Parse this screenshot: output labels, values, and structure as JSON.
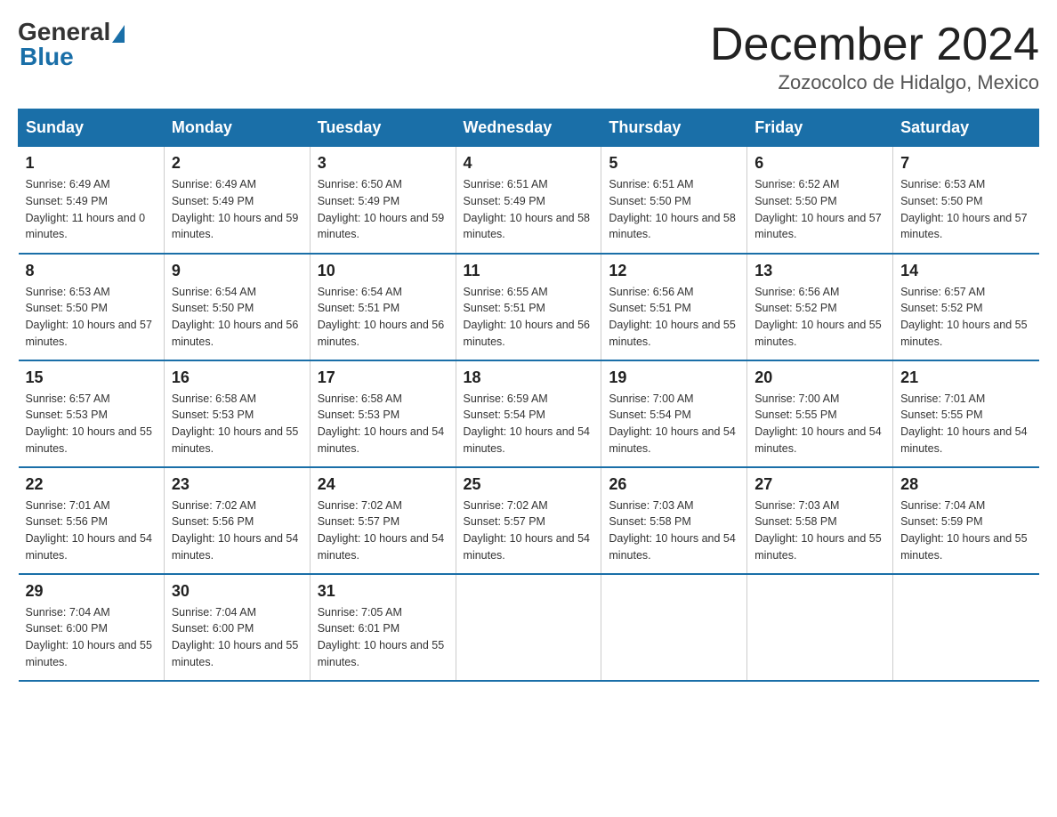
{
  "logo": {
    "general": "General",
    "blue": "Blue"
  },
  "title": "December 2024",
  "subtitle": "Zozocolco de Hidalgo, Mexico",
  "days_of_week": [
    "Sunday",
    "Monday",
    "Tuesday",
    "Wednesday",
    "Thursday",
    "Friday",
    "Saturday"
  ],
  "weeks": [
    [
      {
        "day": "1",
        "sunrise": "6:49 AM",
        "sunset": "5:49 PM",
        "daylight": "11 hours and 0 minutes."
      },
      {
        "day": "2",
        "sunrise": "6:49 AM",
        "sunset": "5:49 PM",
        "daylight": "10 hours and 59 minutes."
      },
      {
        "day": "3",
        "sunrise": "6:50 AM",
        "sunset": "5:49 PM",
        "daylight": "10 hours and 59 minutes."
      },
      {
        "day": "4",
        "sunrise": "6:51 AM",
        "sunset": "5:49 PM",
        "daylight": "10 hours and 58 minutes."
      },
      {
        "day": "5",
        "sunrise": "6:51 AM",
        "sunset": "5:50 PM",
        "daylight": "10 hours and 58 minutes."
      },
      {
        "day": "6",
        "sunrise": "6:52 AM",
        "sunset": "5:50 PM",
        "daylight": "10 hours and 57 minutes."
      },
      {
        "day": "7",
        "sunrise": "6:53 AM",
        "sunset": "5:50 PM",
        "daylight": "10 hours and 57 minutes."
      }
    ],
    [
      {
        "day": "8",
        "sunrise": "6:53 AM",
        "sunset": "5:50 PM",
        "daylight": "10 hours and 57 minutes."
      },
      {
        "day": "9",
        "sunrise": "6:54 AM",
        "sunset": "5:50 PM",
        "daylight": "10 hours and 56 minutes."
      },
      {
        "day": "10",
        "sunrise": "6:54 AM",
        "sunset": "5:51 PM",
        "daylight": "10 hours and 56 minutes."
      },
      {
        "day": "11",
        "sunrise": "6:55 AM",
        "sunset": "5:51 PM",
        "daylight": "10 hours and 56 minutes."
      },
      {
        "day": "12",
        "sunrise": "6:56 AM",
        "sunset": "5:51 PM",
        "daylight": "10 hours and 55 minutes."
      },
      {
        "day": "13",
        "sunrise": "6:56 AM",
        "sunset": "5:52 PM",
        "daylight": "10 hours and 55 minutes."
      },
      {
        "day": "14",
        "sunrise": "6:57 AM",
        "sunset": "5:52 PM",
        "daylight": "10 hours and 55 minutes."
      }
    ],
    [
      {
        "day": "15",
        "sunrise": "6:57 AM",
        "sunset": "5:53 PM",
        "daylight": "10 hours and 55 minutes."
      },
      {
        "day": "16",
        "sunrise": "6:58 AM",
        "sunset": "5:53 PM",
        "daylight": "10 hours and 55 minutes."
      },
      {
        "day": "17",
        "sunrise": "6:58 AM",
        "sunset": "5:53 PM",
        "daylight": "10 hours and 54 minutes."
      },
      {
        "day": "18",
        "sunrise": "6:59 AM",
        "sunset": "5:54 PM",
        "daylight": "10 hours and 54 minutes."
      },
      {
        "day": "19",
        "sunrise": "7:00 AM",
        "sunset": "5:54 PM",
        "daylight": "10 hours and 54 minutes."
      },
      {
        "day": "20",
        "sunrise": "7:00 AM",
        "sunset": "5:55 PM",
        "daylight": "10 hours and 54 minutes."
      },
      {
        "day": "21",
        "sunrise": "7:01 AM",
        "sunset": "5:55 PM",
        "daylight": "10 hours and 54 minutes."
      }
    ],
    [
      {
        "day": "22",
        "sunrise": "7:01 AM",
        "sunset": "5:56 PM",
        "daylight": "10 hours and 54 minutes."
      },
      {
        "day": "23",
        "sunrise": "7:02 AM",
        "sunset": "5:56 PM",
        "daylight": "10 hours and 54 minutes."
      },
      {
        "day": "24",
        "sunrise": "7:02 AM",
        "sunset": "5:57 PM",
        "daylight": "10 hours and 54 minutes."
      },
      {
        "day": "25",
        "sunrise": "7:02 AM",
        "sunset": "5:57 PM",
        "daylight": "10 hours and 54 minutes."
      },
      {
        "day": "26",
        "sunrise": "7:03 AM",
        "sunset": "5:58 PM",
        "daylight": "10 hours and 54 minutes."
      },
      {
        "day": "27",
        "sunrise": "7:03 AM",
        "sunset": "5:58 PM",
        "daylight": "10 hours and 55 minutes."
      },
      {
        "day": "28",
        "sunrise": "7:04 AM",
        "sunset": "5:59 PM",
        "daylight": "10 hours and 55 minutes."
      }
    ],
    [
      {
        "day": "29",
        "sunrise": "7:04 AM",
        "sunset": "6:00 PM",
        "daylight": "10 hours and 55 minutes."
      },
      {
        "day": "30",
        "sunrise": "7:04 AM",
        "sunset": "6:00 PM",
        "daylight": "10 hours and 55 minutes."
      },
      {
        "day": "31",
        "sunrise": "7:05 AM",
        "sunset": "6:01 PM",
        "daylight": "10 hours and 55 minutes."
      },
      null,
      null,
      null,
      null
    ]
  ],
  "colors": {
    "header_bg": "#1a6fa8",
    "header_text": "#ffffff",
    "border": "#1a6fa8"
  }
}
